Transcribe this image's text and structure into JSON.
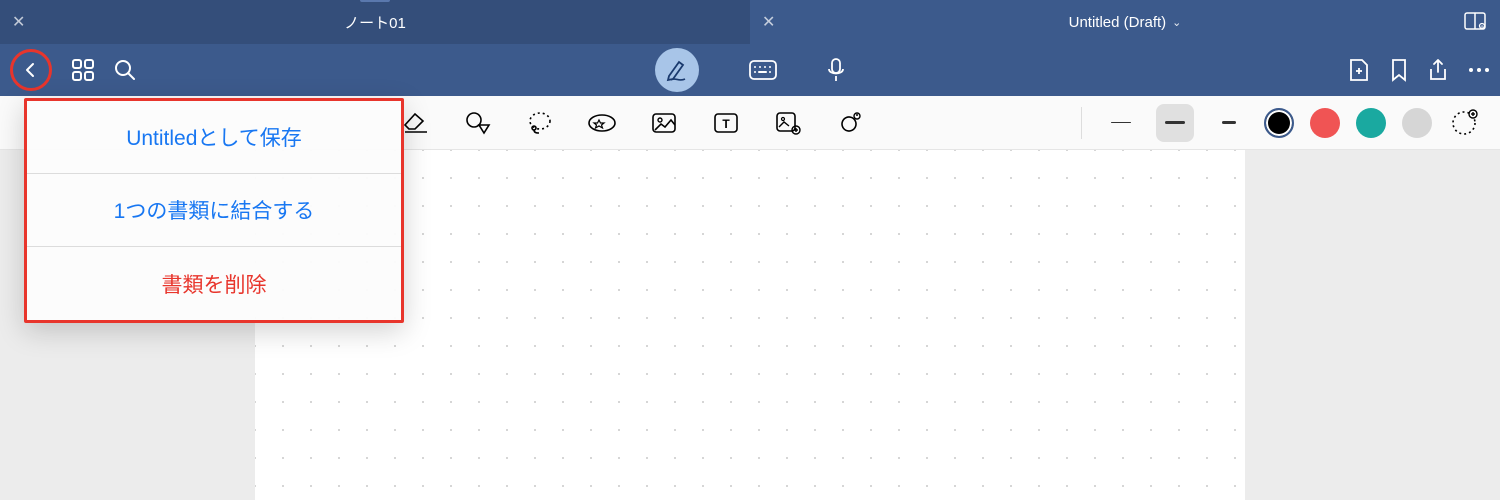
{
  "tabs": {
    "left": {
      "title": "ノート01"
    },
    "right": {
      "title": "Untitled (Draft)"
    }
  },
  "menu": {
    "save": "Untitledとして保存",
    "combine": "1つの書類に結合する",
    "delete": "書類を削除"
  },
  "strokes": {
    "thin": 1,
    "medium": 3,
    "thick": 3
  },
  "colors": {
    "black": "#000000",
    "red": "#f05454",
    "teal": "#1aa9a0",
    "gray": "#d6d6d6"
  }
}
